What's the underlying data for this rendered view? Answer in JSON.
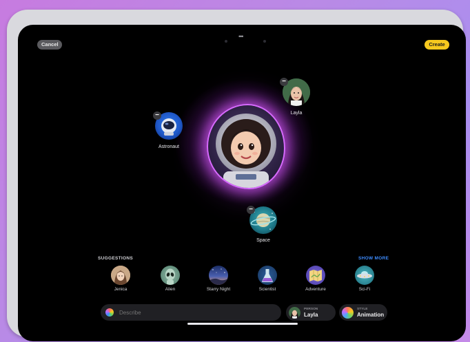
{
  "toolbar": {
    "cancel_label": "Cancel",
    "create_label": "Create",
    "more_icon": "ellipsis-icon"
  },
  "canvas": {
    "bubbles": [
      {
        "label": "Astronaut"
      },
      {
        "label": "Layla"
      },
      {
        "label": "Space"
      }
    ],
    "remove_icon": "minus-icon"
  },
  "suggestions": {
    "title": "SUGGESTIONS",
    "show_more": "SHOW MORE",
    "items": [
      {
        "label": "Jenica"
      },
      {
        "label": "Alien"
      },
      {
        "label": "Starry Night"
      },
      {
        "label": "Scientist"
      },
      {
        "label": "Adventure"
      },
      {
        "label": "Sci-Fi"
      }
    ]
  },
  "bottom_bar": {
    "describe_placeholder": "Describe",
    "person": {
      "caption": "PERSON",
      "value": "Layla"
    },
    "style": {
      "caption": "STYLE",
      "value": "Animation"
    }
  },
  "colors": {
    "accent_create": "#f7c91e",
    "link": "#3d8cff",
    "glow": "#d86bff"
  }
}
